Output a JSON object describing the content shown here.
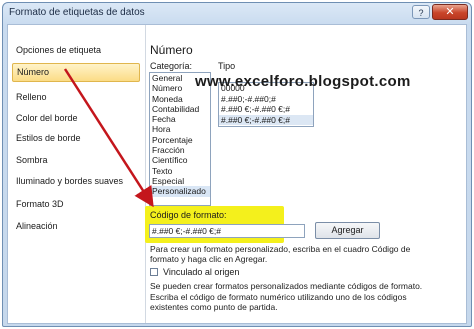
{
  "window": {
    "title": "Formato de etiquetas de datos",
    "help_label": "?",
    "close_label": "✕"
  },
  "nav": {
    "items": [
      {
        "label": "Opciones de etiqueta"
      },
      {
        "label": "Número"
      },
      {
        "label": "Relleno"
      },
      {
        "label": "Color del borde"
      },
      {
        "label": "Estilos de borde"
      },
      {
        "label": "Sombra"
      },
      {
        "label": "Iluminado y bordes suaves"
      },
      {
        "label": "Formato 3D"
      },
      {
        "label": "Alineación"
      }
    ],
    "selected_index": 1
  },
  "panel": {
    "title": "Número",
    "category_label": "Categoría:",
    "type_label": "Tipo",
    "categories": [
      "General",
      "Número",
      "Moneda",
      "Contabilidad",
      "Fecha",
      "Hora",
      "Porcentaje",
      "Fracción",
      "Científico",
      "Texto",
      "Especial",
      "Personalizado"
    ],
    "selected_category": "Personalizado",
    "types": [
      "00000",
      "#.##0;-#.##0;#",
      "#.##0 €;-#.##0 €;#",
      "#.##0 €;-#.##0 €;#"
    ],
    "watermark": "www.excelforo.blogspot.com",
    "format_code_label": "Código de formato:",
    "format_code_value": "#.##0 €;-#.##0 €;#",
    "add_button": "Agregar",
    "help_text_1a": "Para crear un formato personalizado, escriba en el cuadro Código de",
    "help_text_1b": "formato y haga clic en Agregar.",
    "linked_label": "Vinculado al origen",
    "linked_checked": false,
    "help_text_2a": "Se pueden crear formatos personalizados mediante códigos de formato.",
    "help_text_2b": "Escriba el código de formato numérico utilizando uno de los códigos",
    "help_text_2c": "existentes como punto de partida."
  },
  "colors": {
    "highlight": "#f4f01c",
    "arrow": "#c4161c",
    "selection": "#fbdc86"
  }
}
